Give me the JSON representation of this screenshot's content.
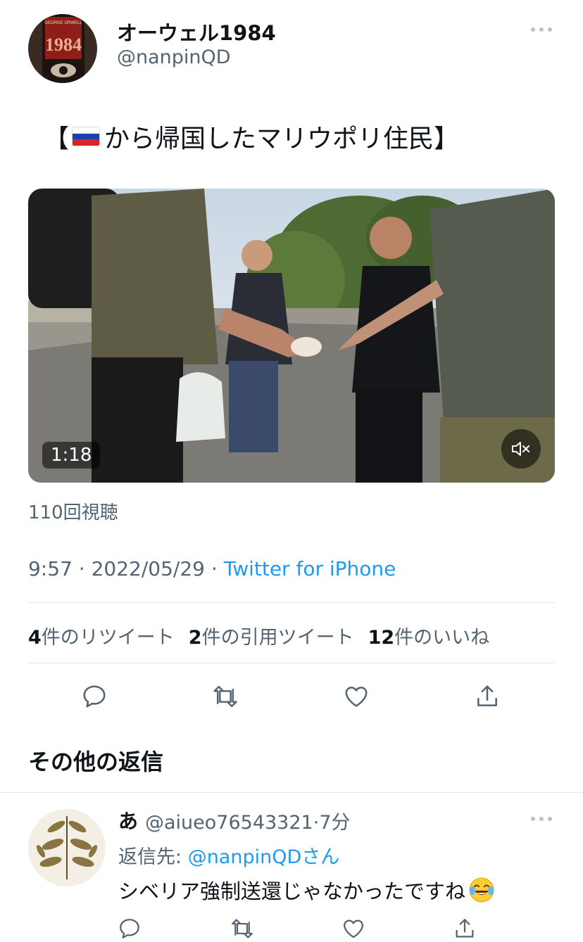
{
  "tweet": {
    "author": {
      "display_name": "オーウェル1984",
      "handle": "@nanpinQD",
      "avatar_text_top": "GEORGE ORWELL",
      "avatar_text_main": "1984"
    },
    "text_open": "【",
    "text_body": "から帰国したマリウポリ住民】",
    "flag": "russia-flag",
    "video": {
      "duration": "1:18",
      "muted": true
    },
    "views": "110回視聴",
    "time": "9:57",
    "separator": "·",
    "date": "2022/05/29",
    "client": "Twitter for iPhone",
    "stats": {
      "retweets_count": "4",
      "retweets_label": "件のリツイート",
      "quotes_count": "2",
      "quotes_label": "件の引用ツイート",
      "likes_count": "12",
      "likes_label": "件のいいね"
    }
  },
  "section_title": "その他の返信",
  "reply": {
    "display_name": "あ",
    "handle": "@aiueo76543321",
    "separator": "·",
    "time": "7分",
    "reply_to_label": "返信先: ",
    "reply_to_handle": "@nanpinQD",
    "reply_to_suffix": "さん",
    "text": "シベリア強制送還じゃなかったですね",
    "emoji": "joy-emoji"
  },
  "colors": {
    "link": "#1d9bf0",
    "secondary_text": "#536471",
    "primary_text": "#0f1419",
    "divider": "#e1e6ea"
  }
}
